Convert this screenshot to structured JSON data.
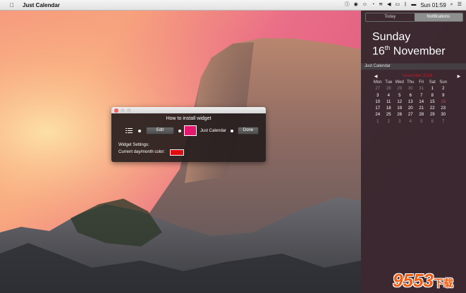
{
  "menubar": {
    "apple_icon": "apple-icon",
    "app_name": "Just Calendar",
    "status_icons": [
      "info-icon",
      "record-icon",
      "user-icon",
      "timer-icon",
      "wifi-icon",
      "volume-icon",
      "battery-icon",
      "bluetooth-icon",
      "flag-icon"
    ],
    "clock": "Sun 01:59",
    "search_icon": "search-icon",
    "list_icon": "list-icon"
  },
  "notification_center": {
    "tabs": [
      {
        "label": "Today",
        "active": false
      },
      {
        "label": "Notifications",
        "active": true
      }
    ],
    "day_of_week": "Sunday",
    "date_day": "16",
    "date_suffix": "th",
    "date_month": "November",
    "widget_title": "Just Calendar",
    "edit_label": "Edit",
    "calendar": {
      "month_title": "November 2014",
      "prev_icon": "left-arrow-icon",
      "next_icon": "right-arrow-icon",
      "weekdays": [
        "Mon",
        "Tue",
        "Wed",
        "Thu",
        "Fri",
        "Sat",
        "Sun"
      ],
      "weeks": [
        [
          "27",
          "28",
          "29",
          "30",
          "31",
          "1",
          "2"
        ],
        [
          "3",
          "4",
          "5",
          "6",
          "7",
          "8",
          "9"
        ],
        [
          "10",
          "11",
          "12",
          "13",
          "14",
          "15",
          "16"
        ],
        [
          "17",
          "18",
          "19",
          "20",
          "21",
          "22",
          "23"
        ],
        [
          "24",
          "25",
          "26",
          "27",
          "28",
          "29",
          "30"
        ],
        [
          "1",
          "2",
          "3",
          "4",
          "5",
          "6",
          "7"
        ]
      ],
      "today": "16"
    }
  },
  "dialog": {
    "title": "How to install widget",
    "edit_button": "Edit",
    "swatch_label": "Just Calendar",
    "done_button": "Done",
    "settings_label": "Widget Settings:",
    "color_label": "Current day/month color:",
    "current_color": "#e10b10",
    "swatch_color": "#e4166e"
  },
  "watermark": {
    "text": "9553",
    "suffix": "下载"
  }
}
